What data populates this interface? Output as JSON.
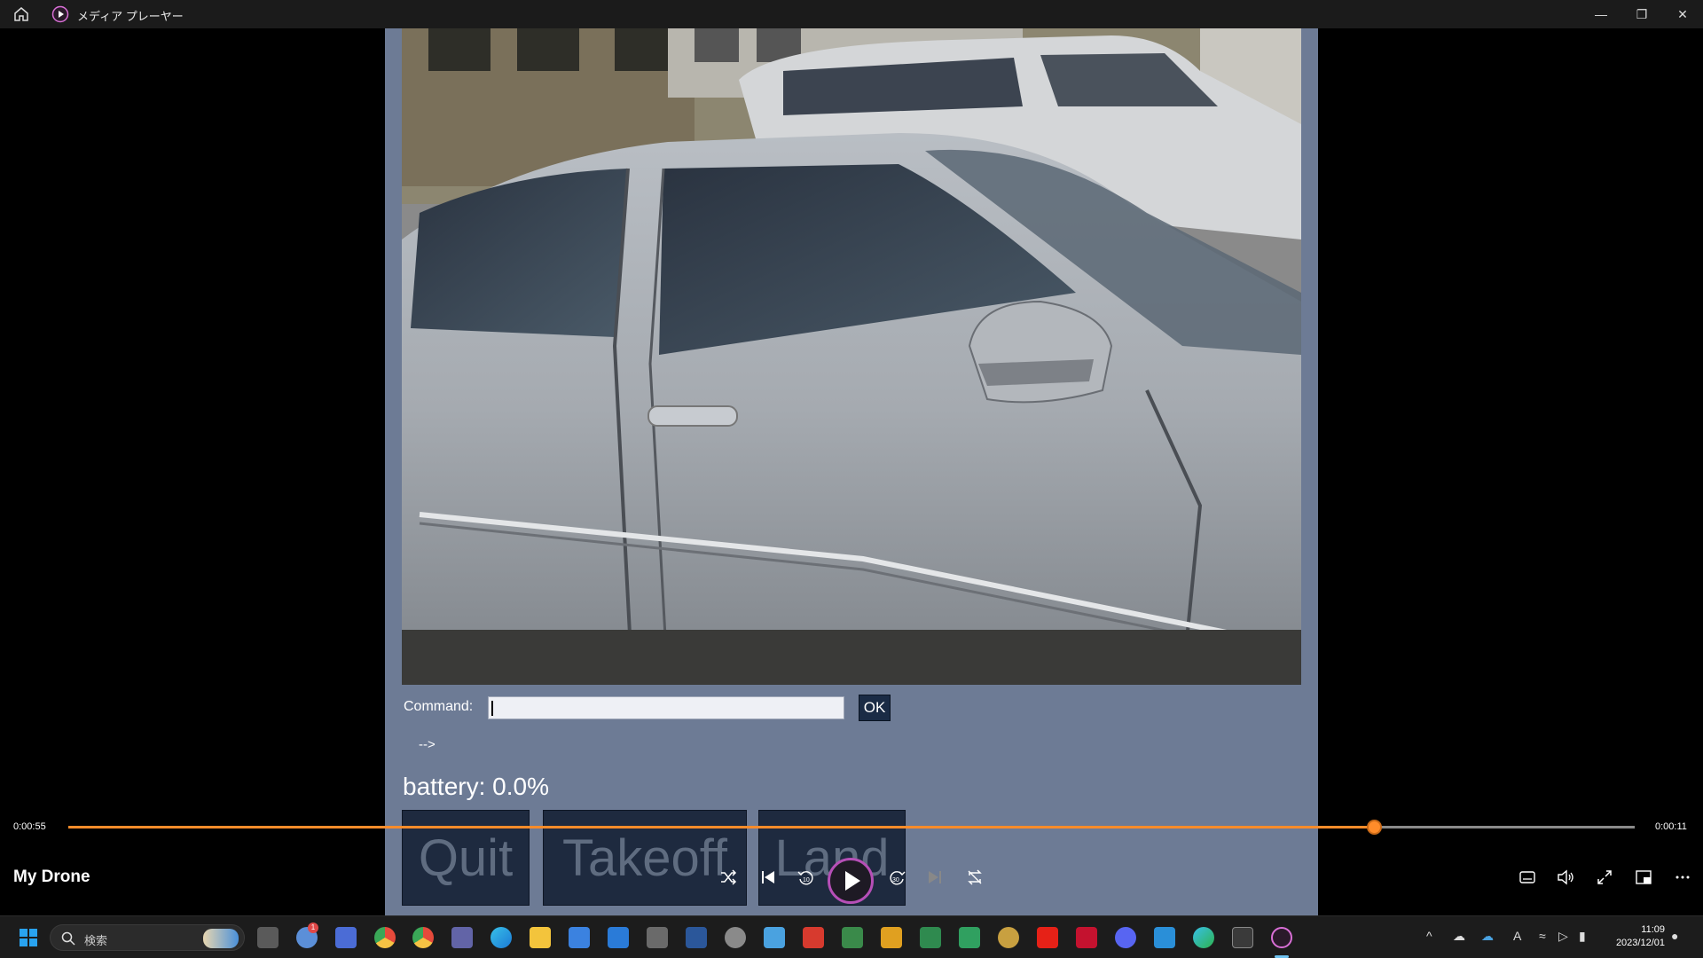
{
  "titlebar": {
    "app_title": "メディア プレーヤー",
    "icons": [
      "home-icon",
      "media-player-icon"
    ],
    "window_buttons": [
      "minimize",
      "restore",
      "close"
    ]
  },
  "video_app": {
    "command_label": "Command:",
    "command_value": "",
    "ok_label": "OK",
    "response_text": "-->",
    "battery_text": "battery: 0.0%",
    "buttons": [
      "Quit",
      "Takeoff",
      "Land"
    ]
  },
  "player": {
    "elapsed": "0:00:55",
    "remaining": "0:00:11",
    "progress_fraction": 0.8333,
    "media_title": "My Drone",
    "accent_color": "#ff8c2a",
    "controls": [
      "shuffle-icon",
      "previous-icon",
      "skip-back-10-icon",
      "play-icon",
      "skip-forward-30-icon",
      "next-icon",
      "repeat-icon"
    ],
    "right_controls": [
      "captions-icon",
      "volume-icon",
      "fullscreen-icon",
      "miniplayer-icon",
      "more-icon"
    ],
    "skip_back_label": "10",
    "skip_forward_label": "30"
  },
  "taskbar": {
    "search_placeholder": "検索",
    "notification_badge": "1",
    "clock_time": "11:09",
    "clock_date": "2023/12/01",
    "ime_indicator": "A"
  }
}
